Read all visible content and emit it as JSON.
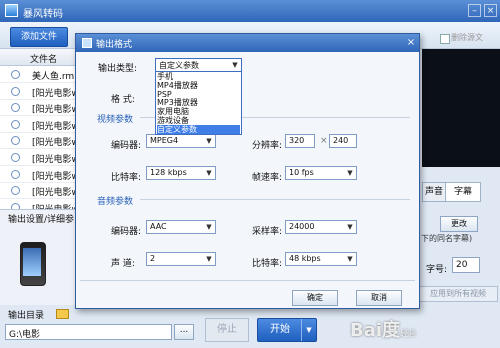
{
  "app": {
    "title": "暴风转码",
    "minimize": "–",
    "close": "×"
  },
  "toolbar": {
    "add_file": "添加文件",
    "delete_source": "删除源文"
  },
  "file_list": {
    "header": "文件名",
    "items": [
      "美人鱼.rm",
      "[阳光电影w",
      "[阳光电影w",
      "[阳光电影w",
      "[阳光电影w",
      "[阳光电影w",
      "[阳光电影w",
      "[阳光电影w",
      "[阳光电影w"
    ]
  },
  "output_settings_label": "输出设置/详细参",
  "output_dir": {
    "label": "输出目录",
    "path": "G:\\电影",
    "browse": "..."
  },
  "controls": {
    "stop": "停止",
    "start": "开始",
    "start_arrow": "▼"
  },
  "right_panel": {
    "tab_sound": "声音",
    "tab_subtitle": "字幕",
    "change_button": "更改",
    "subtitle_name_note": "下的同名字幕)",
    "font_size_label": "字号:",
    "font_size_value": "20",
    "apply_all": "应用到所有视频"
  },
  "dialog": {
    "title": "输出格式",
    "close": "×",
    "output_type_label": "输出类型:",
    "output_type_value": "自定义参数",
    "format_label": "格  式:",
    "dropdown_options": [
      "手机",
      "MP4播放器",
      "PSP",
      "MP3播放器",
      "家用电脑",
      "游戏设备",
      "自定义参数"
    ],
    "selected_option_index": 6,
    "video_section": "视频参数",
    "encoder_label": "编码器:",
    "video_encoder": "MPEG4",
    "resolution_label": "分辨率:",
    "res_width": "320",
    "res_sep": "×",
    "res_height": "240",
    "bitrate_label": "比特率:",
    "video_bitrate": "128 kbps",
    "framerate_label": "帧速率:",
    "framerate": "10 fps",
    "audio_section": "音频参数",
    "audio_encoder_label": "编码器:",
    "audio_encoder": "AAC",
    "samplerate_label": "采样率:",
    "samplerate": "24000",
    "channels_label": "声  道:",
    "channels": "2",
    "audio_bitrate_label": "比特率:",
    "audio_bitrate": "48 kbps",
    "ok": "确定",
    "cancel": "取消"
  },
  "watermark": {
    "text": "Bai度",
    "sub": "经验"
  }
}
